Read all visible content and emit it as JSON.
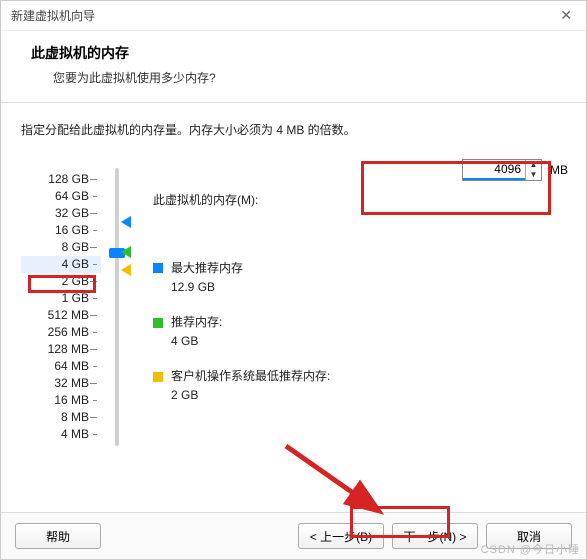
{
  "window": {
    "title": "新建虚拟机向导"
  },
  "header": {
    "title": "此虚拟机的内存",
    "subtitle": "您要为此虚拟机使用多少内存?"
  },
  "instruction": "指定分配给此虚拟机的内存量。内存大小必须为 4 MB 的倍数。",
  "memory": {
    "label": "此虚拟机的内存(M):",
    "value": "4096",
    "unit": "MB"
  },
  "scale": {
    "ticks": [
      "128 GB",
      "64 GB",
      "32 GB",
      "16 GB",
      "8 GB",
      "4 GB",
      "2 GB",
      "1 GB",
      "512 MB",
      "256 MB",
      "128 MB",
      "64 MB",
      "32 MB",
      "16 MB",
      "8 MB",
      "4 MB"
    ],
    "selected_index": 5
  },
  "legend": {
    "max": {
      "label": "最大推荐内存",
      "value": "12.9 GB"
    },
    "rec": {
      "label": "推荐内存:",
      "value": "4 GB"
    },
    "min": {
      "label": "客户机操作系统最低推荐内存:",
      "value": "2 GB"
    }
  },
  "buttons": {
    "help": "帮助",
    "back": "< 上一步(B)",
    "next": "下一步(N) >",
    "cancel": "取消"
  },
  "watermark": "CSDN @今日小睡"
}
